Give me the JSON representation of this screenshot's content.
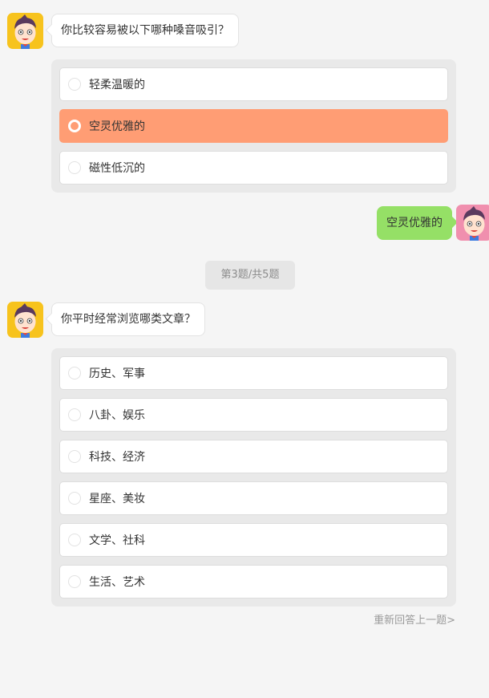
{
  "conversation": [
    {
      "question": "你比较容易被以下哪种嗓音吸引？",
      "options": [
        {
          "label": "轻柔温暖的",
          "selected": false
        },
        {
          "label": "空灵优雅的",
          "selected": true
        },
        {
          "label": "磁性低沉的",
          "selected": false
        }
      ]
    }
  ],
  "user_reply": "空灵优雅的",
  "progress_label": "第3题/共5题",
  "current_question": {
    "question": "你平时经常浏览哪类文章？",
    "options": [
      {
        "label": "历史、军事",
        "selected": false
      },
      {
        "label": "八卦、娱乐",
        "selected": false
      },
      {
        "label": "科技、经济",
        "selected": false
      },
      {
        "label": "星座、美妆",
        "selected": false
      },
      {
        "label": "文学、社科",
        "selected": false
      },
      {
        "label": "生活、艺术",
        "selected": false
      }
    ]
  },
  "redo_link": "重新回答上一题>",
  "colors": {
    "selected_option": "#ff9d74",
    "user_bubble": "#95e066",
    "bot_avatar_bg": "#f7c31d",
    "user_avatar_bg": "#f08fae"
  },
  "icons": {
    "bot_avatar": "cartoon-boy-avatar-icon",
    "user_avatar": "cartoon-boy-avatar-icon",
    "radio": "radio-circle-icon"
  }
}
